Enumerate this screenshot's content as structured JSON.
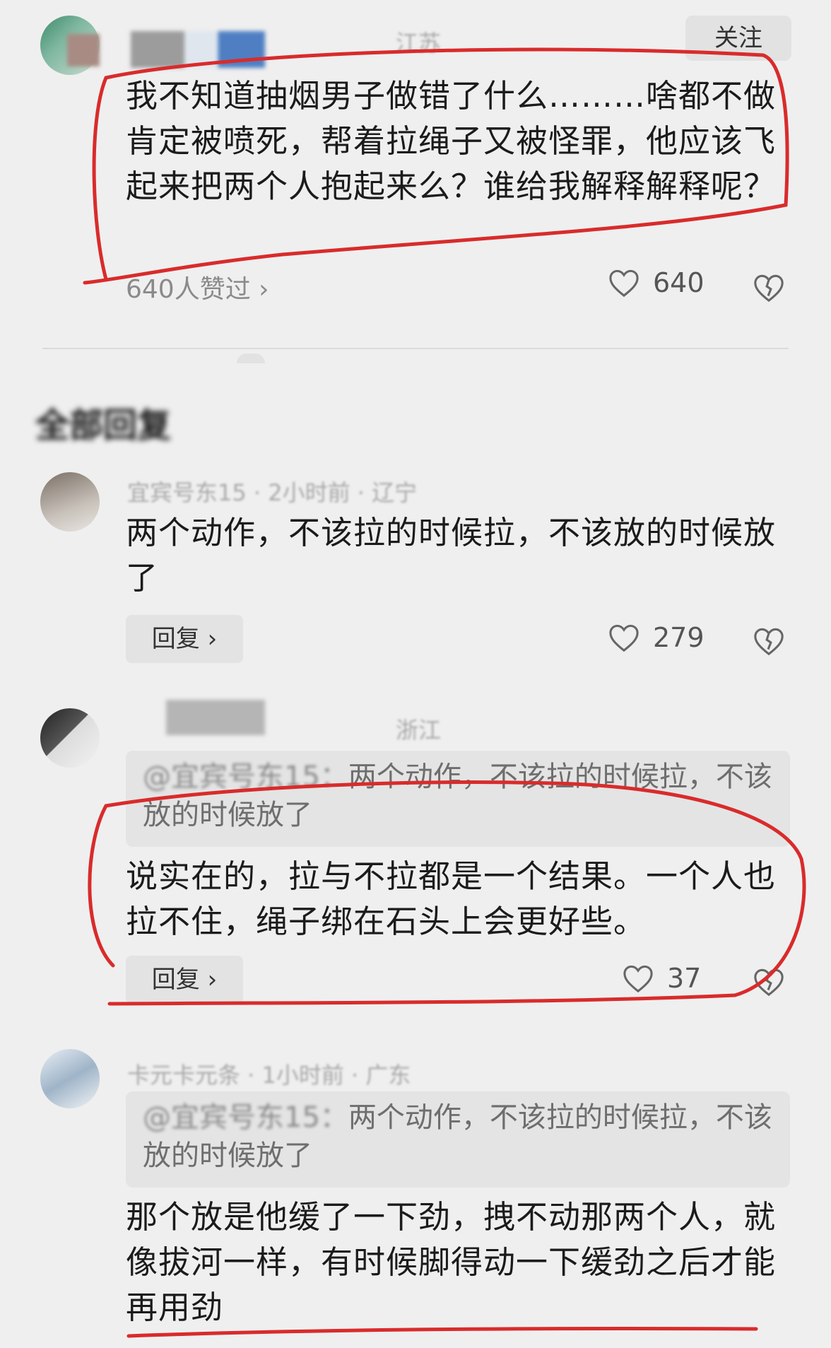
{
  "top_comment": {
    "location": "江苏",
    "follow_label": "关注",
    "text": "我不知道抽烟男子做错了什么………啥都不做肯定被喷死，帮着拉绳子又被怪罪，他应该飞起来把两个人抱起来么？谁给我解释解释呢？",
    "liked_by": "640人赞过 ›",
    "like_count": "640"
  },
  "section_title": "全部回复",
  "replies": [
    {
      "meta": "宜宾号东15 · 2小时前 · 辽宁",
      "text": "两个动作，不该拉的时候拉，不该放的时候放了",
      "reply_label": "回复 ›",
      "like_count": "279"
    },
    {
      "meta": "浙江",
      "quote_name": "@宜宾号东15：",
      "quote_text": "两个动作，不该拉的时候拉，不该放的时候放了",
      "text": "说实在的，拉与不拉都是一个结果。一个人也拉不住，绳子绑在石头上会更好些。",
      "reply_label": "回复 ›",
      "like_count": "37"
    },
    {
      "meta": "卡元卡元条 · 1小时前 · 广东",
      "quote_name": "@宜宾号东15：",
      "quote_text": "两个动作，不该拉的时候拉，不该放的时候放了",
      "text": "那个放是他缓了一下劲，拽不动那两个人，就像拔河一样，有时候脚得动一下缓劲之后才能再用劲"
    }
  ],
  "colors": {
    "annotation_red": "#d92b2b",
    "background": "#efefef"
  },
  "icons": [
    "heart-icon",
    "dislike-heart-icon",
    "chevron-right-icon"
  ]
}
